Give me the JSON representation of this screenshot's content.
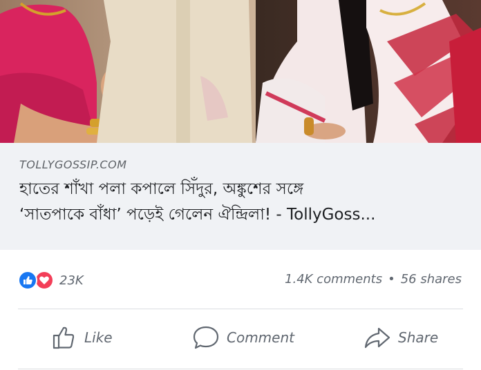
{
  "link_preview": {
    "domain": "TOLLYGOSSIP.COM",
    "headline_line1": "হাতের শাঁখা পলা কপালে সিঁদুর, অঙ্কুশের সঙ্গে",
    "headline_line2": "‘সাতপাকে বাঁধা’ পড়েই গেলেন ঐন্দ্রিলা! - TollyGoss..."
  },
  "stats": {
    "reaction_count": "23K",
    "comments": "1.4K comments",
    "separator": "•",
    "shares": "56 shares"
  },
  "actions": {
    "like_label": "Like",
    "comment_label": "Comment",
    "share_label": "Share"
  },
  "colors": {
    "like_blue": "#1877f2",
    "love_red": "#f33e58",
    "card_bg": "#f0f2f5",
    "muted_text": "#606770"
  },
  "icons": [
    "photo",
    "like-reaction-icon",
    "love-reaction-icon",
    "thumbs-up-icon",
    "comment-bubble-icon",
    "share-arrow-icon"
  ]
}
